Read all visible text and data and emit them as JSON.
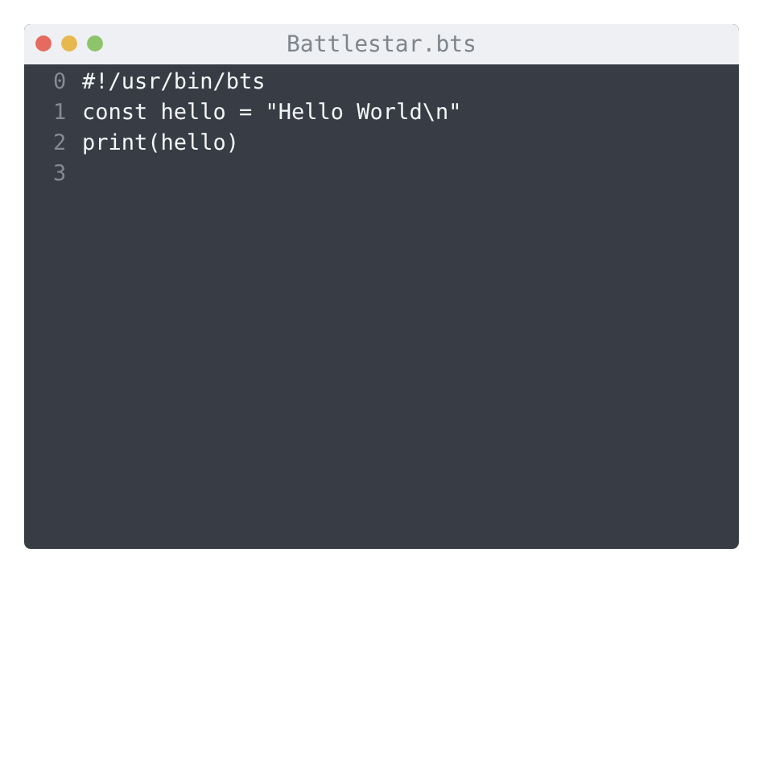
{
  "window": {
    "title": "Battlestar.bts",
    "controls": [
      {
        "color": "#e56a5f"
      },
      {
        "color": "#e6b84e"
      },
      {
        "color": "#8dc36b"
      }
    ]
  },
  "editor": {
    "lines": [
      {
        "number": "0",
        "code": "#!/usr/bin/bts"
      },
      {
        "number": "1",
        "code": "const hello = \"Hello World\\n\""
      },
      {
        "number": "2",
        "code": "print(hello)"
      },
      {
        "number": "3"
      }
    ]
  }
}
